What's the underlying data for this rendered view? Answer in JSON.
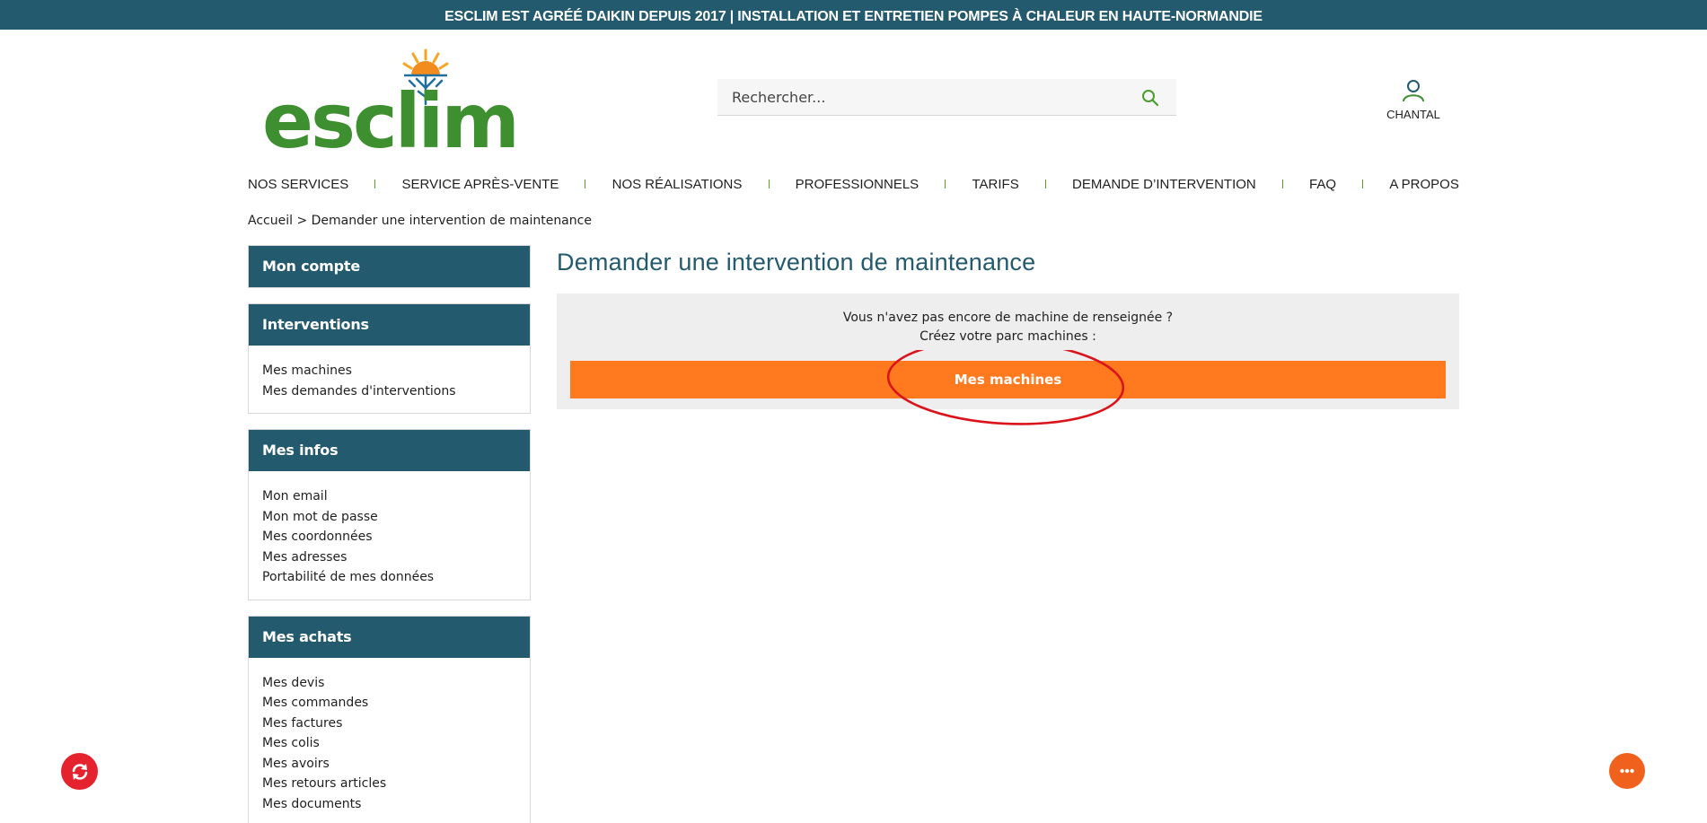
{
  "topbar": {
    "text": "ESCLIM EST AGRÉÉ DAIKIN DEPUIS 2017 | INSTALLATION ET ENTRETIEN POMPES À CHALEUR EN HAUTE-NORMANDIE"
  },
  "logo": {
    "text": "esclim",
    "icon": "sun-snowflake-logo-icon"
  },
  "search": {
    "placeholder": "Rechercher...",
    "icon": "search-icon"
  },
  "account": {
    "name": "CHANTAL",
    "icon": "user-icon"
  },
  "nav": {
    "items": [
      "NOS SERVICES",
      "SERVICE APRÈS-VENTE",
      "NOS RÉALISATIONS",
      "PROFESSIONNELS",
      "TARIFS",
      "DEMANDE D’INTERVENTION",
      "FAQ",
      "A PROPOS"
    ]
  },
  "breadcrumb": {
    "text": "Accueil > Demander une intervention de maintenance"
  },
  "sidebar": {
    "mon_compte": {
      "title": "Mon compte"
    },
    "interventions": {
      "title": "Interventions",
      "links": [
        "Mes machines",
        "Mes demandes d'interventions"
      ]
    },
    "mes_infos": {
      "title": "Mes infos",
      "links": [
        "Mon email",
        "Mon mot de passe",
        "Mes coordonnées",
        "Mes adresses",
        "Portabilité de mes données"
      ]
    },
    "mes_achats": {
      "title": "Mes achats",
      "links": [
        "Mes devis",
        "Mes commandes",
        "Mes factures",
        "Mes colis",
        "Mes avoirs",
        "Mes retours articles",
        "Mes documents"
      ]
    }
  },
  "main": {
    "title": "Demander une intervention de maintenance",
    "notice_line1": "Vous n'avez pas encore de machine de renseignée ?",
    "notice_line2": "Créez votre parc machines :",
    "button_label": "Mes machines"
  },
  "colors": {
    "brand_dark": "#245a6e",
    "brand_green": "#3d8f2f",
    "cta_orange": "#ff7a1f",
    "annotation_red": "#d9141c"
  },
  "floating": {
    "left_icon": "refresh-icon",
    "right_icon": "more-dots-icon"
  }
}
